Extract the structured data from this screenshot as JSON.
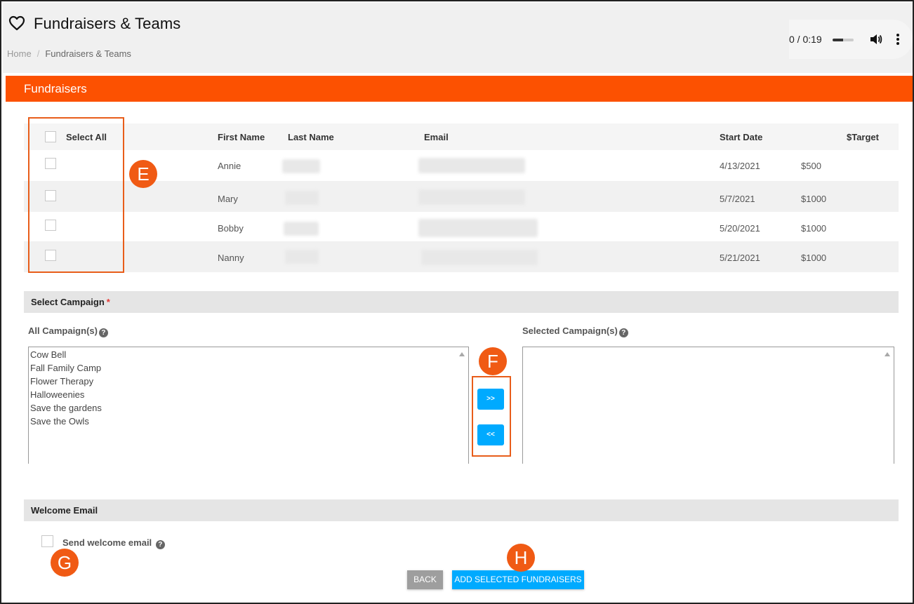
{
  "header": {
    "title": "Fundraisers & Teams",
    "breadcrumb": [
      "Home",
      "Fundraisers & Teams"
    ],
    "icon": "heart-icon"
  },
  "audio_player": {
    "time": "0 / 0:19",
    "progress": 0.5,
    "icons": [
      "volume-icon",
      "more-vert-icon"
    ]
  },
  "panel": {
    "title": "Fundraisers",
    "accent_color": "#fc5101"
  },
  "table": {
    "select_all_label": "Select All",
    "columns": [
      "First Name",
      "Last Name",
      "Email",
      "Start Date",
      "$Target"
    ],
    "rows": [
      {
        "first_name": "Annie",
        "start_date": "4/13/2021",
        "target": "$500"
      },
      {
        "first_name": "Mary",
        "start_date": "5/7/2021",
        "target": "$1000"
      },
      {
        "first_name": "Bobby",
        "start_date": "5/20/2021",
        "target": "$1000"
      },
      {
        "first_name": "Nanny",
        "start_date": "5/21/2021",
        "target": "$1000"
      }
    ]
  },
  "campaign": {
    "section_title": "Select Campaign",
    "required_mark": "*",
    "all_label": "All Campaign(s)",
    "selected_label": "Selected Campaign(s)",
    "all_options": [
      "Cow Bell",
      "Fall Family Camp",
      "Flower Therapy",
      "Halloweenies",
      "Save the gardens",
      "Save the Owls"
    ],
    "selected_options": [],
    "move_right_label": ">>",
    "move_left_label": "<<"
  },
  "welcome": {
    "section_title": "Welcome Email",
    "checkbox_label": "Send welcome email"
  },
  "actions": {
    "back_label": "BACK",
    "add_label": "ADD SELECTED FUNDRAISERS"
  },
  "markers": {
    "e": "E",
    "f": "F",
    "g": "G",
    "h": "H",
    "color": "#f05a14"
  },
  "colors": {
    "primary_button": "#00aaff",
    "secondary_button": "#9e9e9e"
  }
}
